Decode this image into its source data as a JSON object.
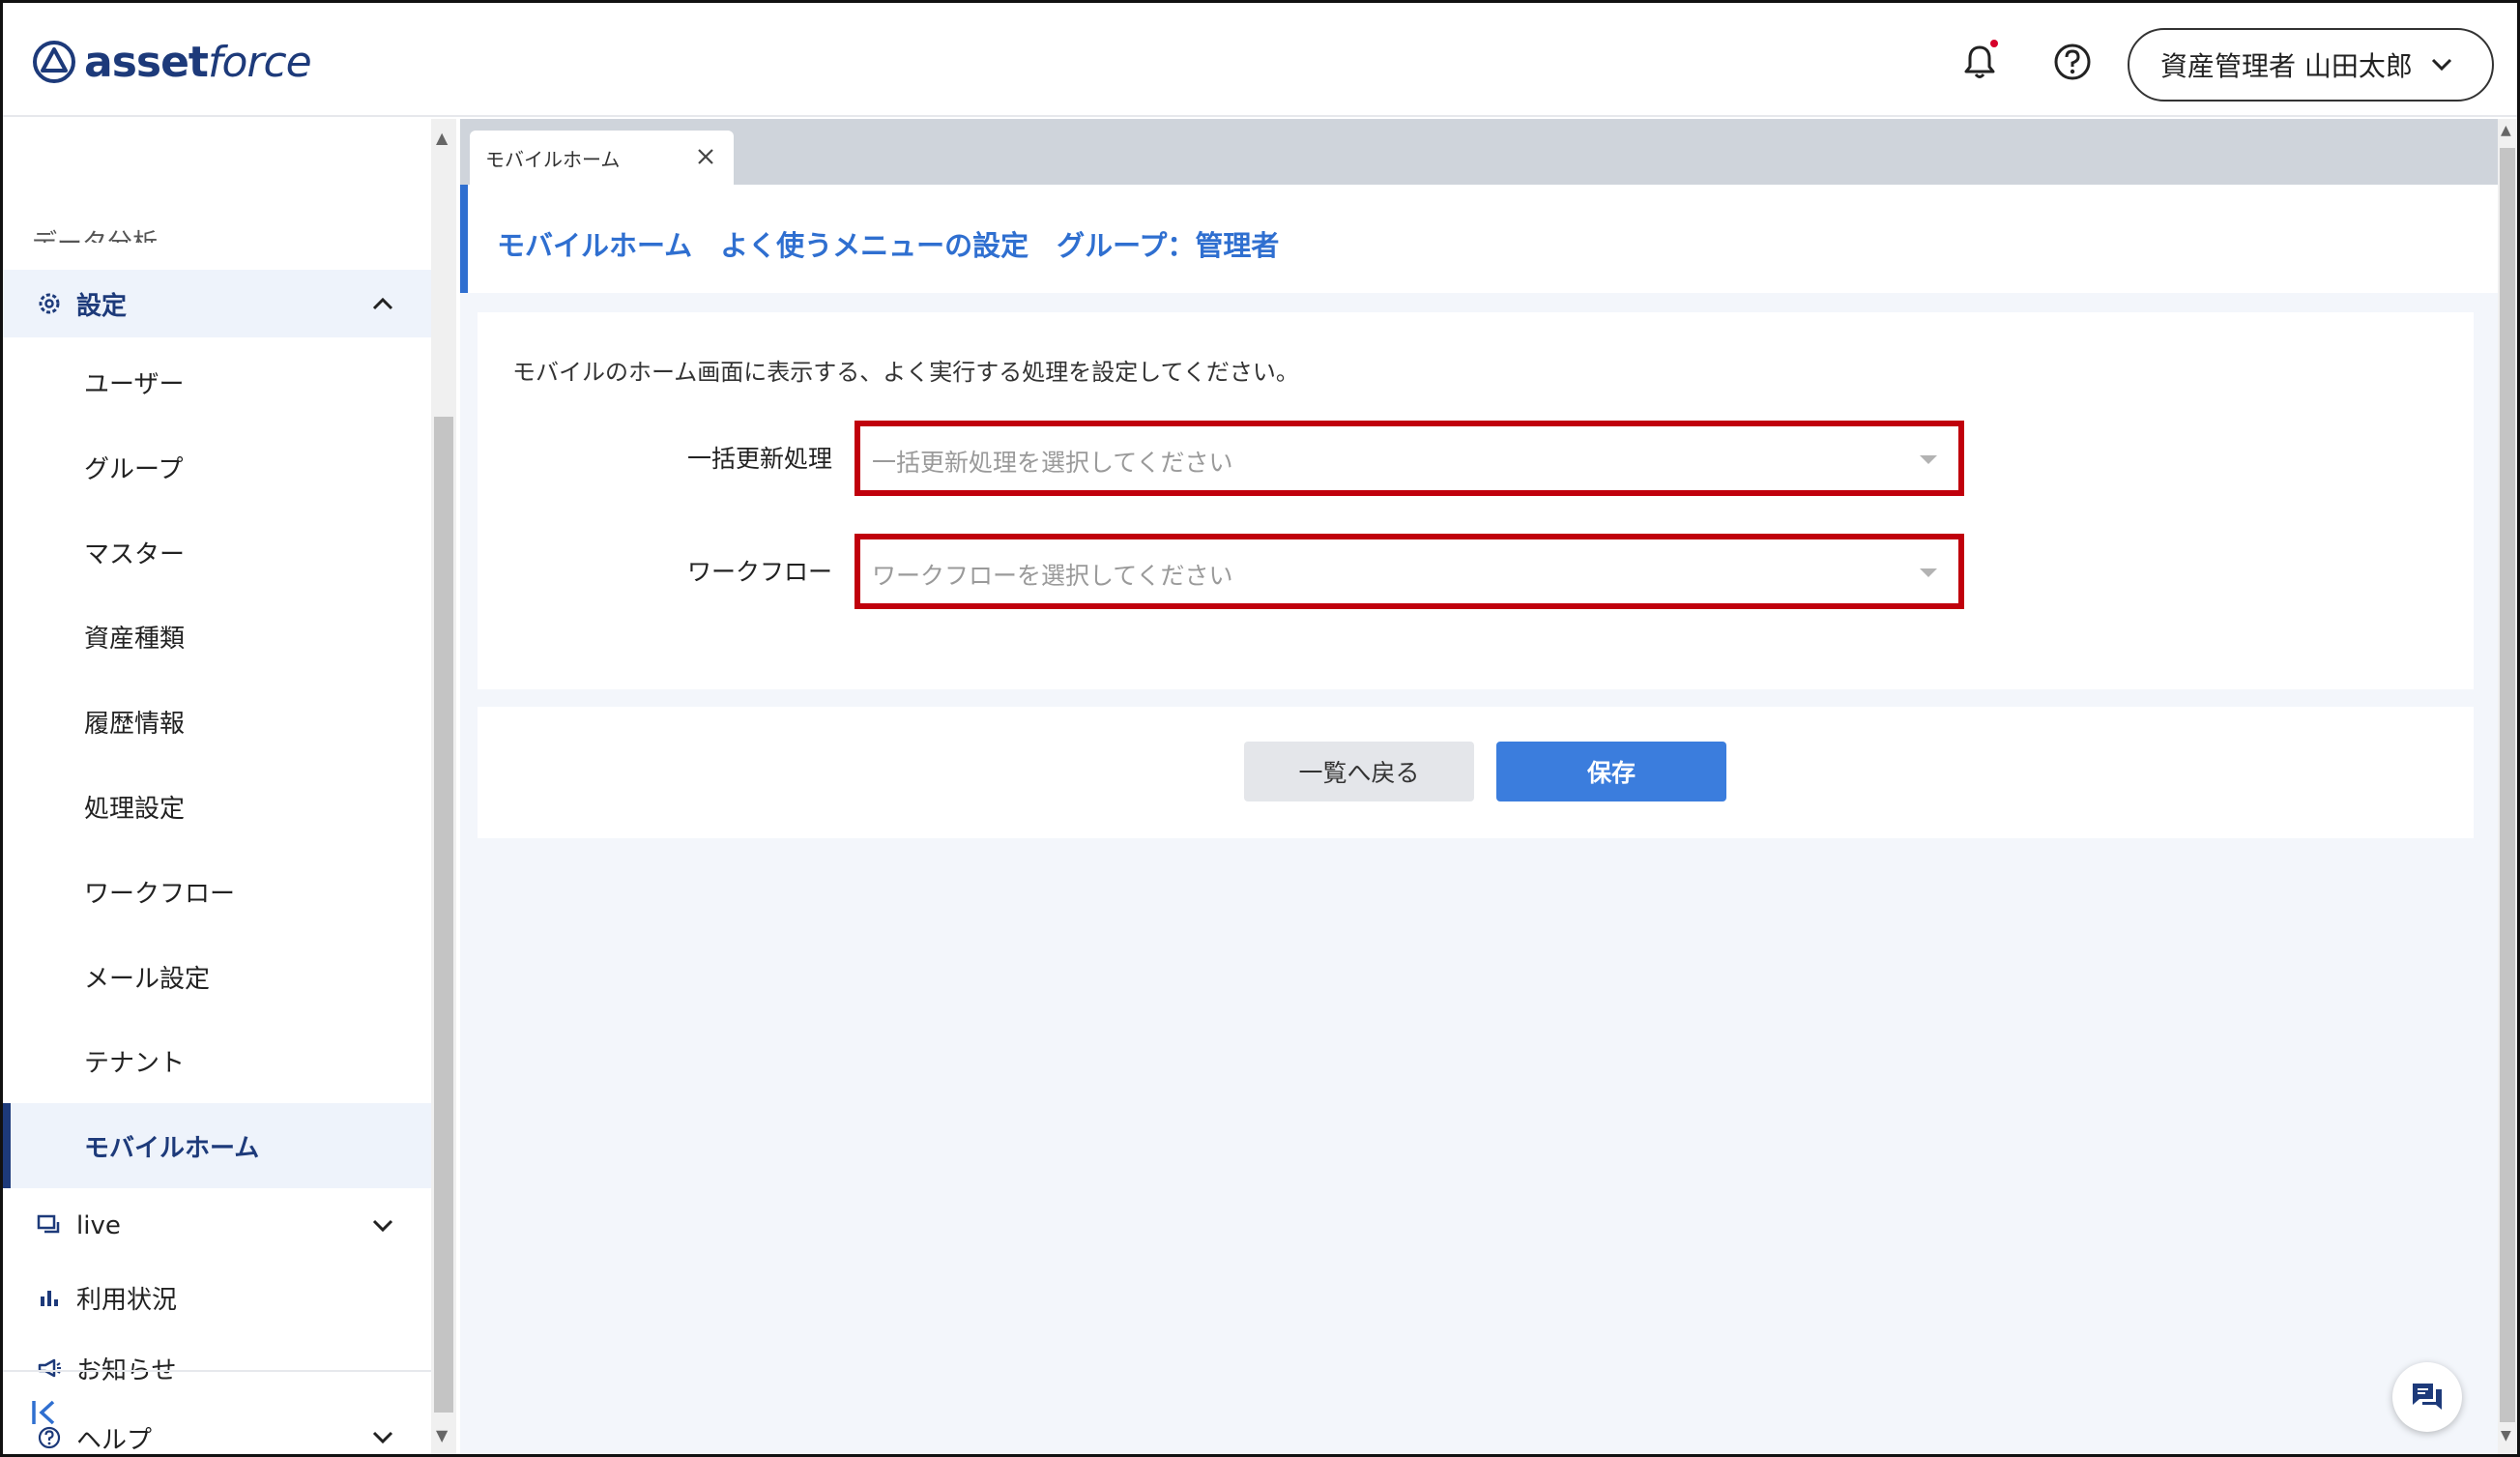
{
  "brand": {
    "name_bold": "asset",
    "name_light": "force",
    "color": "#1d3a7a"
  },
  "header": {
    "user_label": "資産管理者 山田太郎",
    "icons": [
      "bell-icon",
      "help-circle-icon",
      "chevron-down-icon"
    ],
    "notification_dot_color": "#d6002a"
  },
  "sidebar": {
    "partial_item": "データ分析",
    "settings_group": {
      "label": "設定",
      "icon": "gear-icon",
      "expanded": true
    },
    "settings_items": [
      {
        "label": "ユーザー"
      },
      {
        "label": "グループ"
      },
      {
        "label": "マスター"
      },
      {
        "label": "資産種類"
      },
      {
        "label": "履歴情報"
      },
      {
        "label": "処理設定"
      },
      {
        "label": "ワークフロー"
      },
      {
        "label": "メール設定"
      },
      {
        "label": "テナント"
      },
      {
        "label": "モバイルホーム",
        "active": true
      }
    ],
    "other_groups": [
      {
        "label": "live",
        "icon": "chat-icon",
        "has_chevron": true
      },
      {
        "label": "利用状況",
        "icon": "bar-chart-icon",
        "has_chevron": false
      },
      {
        "label": "お知らせ",
        "icon": "megaphone-icon",
        "has_chevron": false
      },
      {
        "label": "ヘルプ",
        "icon": "help-circle-icon",
        "has_chevron": true
      }
    ],
    "collapse_icon": "collapse-sidebar-icon"
  },
  "tabs": [
    {
      "label": "モバイルホーム",
      "closable": true
    }
  ],
  "page": {
    "title": "モバイルホーム　よく使うメニューの設定　グループ：管理者",
    "description": "モバイルのホーム画面に表示する、よく実行する処理を設定してください。",
    "fields": {
      "bulk_update": {
        "label": "一括更新処理",
        "placeholder": "一括更新処理を選択してください"
      },
      "workflow": {
        "label": "ワークフロー",
        "placeholder": "ワークフローを選択してください"
      }
    },
    "buttons": {
      "back": "一覧へ戻る",
      "save": "保存"
    }
  },
  "colors": {
    "accent": "#2f6fd0",
    "primary_button": "#3b7ddd",
    "highlight_border": "#c0000c"
  }
}
